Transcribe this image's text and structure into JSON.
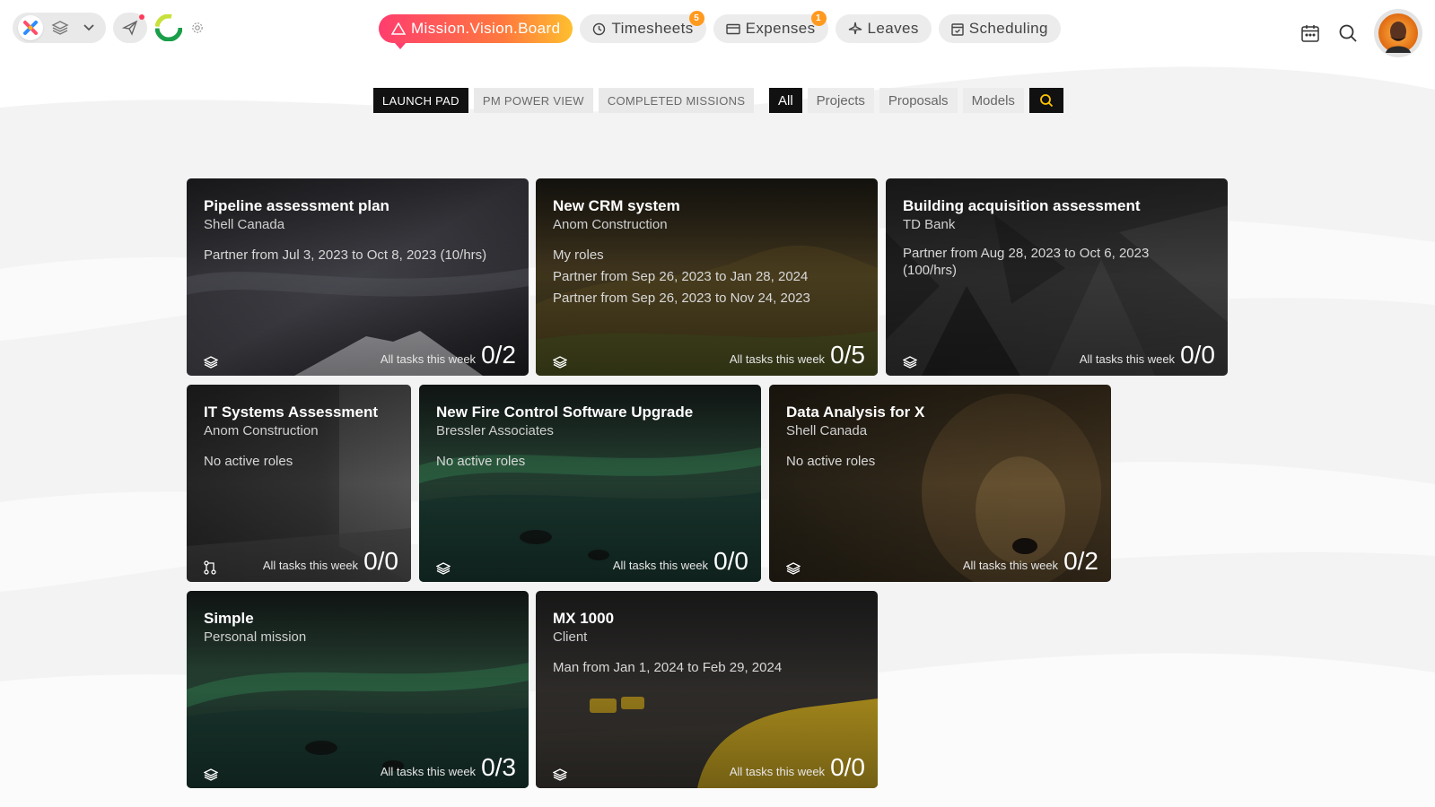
{
  "colors": {
    "accent_gradient": [
      "#ff3d6e",
      "#ff7a3d",
      "#ffbf2f"
    ],
    "badge": "#ff9a1f",
    "dark": "#111111",
    "search_glyph": "#ffc400"
  },
  "topbar": {
    "left_icons": [
      "app-logo-icon",
      "layers-icon",
      "chevron-down-icon",
      "send-icon",
      "sync-status-icon",
      "settings-icon"
    ],
    "nav_tabs": [
      {
        "label": "Mission.Vision.Board",
        "icon": "warning-triangle-icon",
        "active": true,
        "badge": ""
      },
      {
        "label": "Timesheets",
        "icon": "clock-icon",
        "active": false,
        "badge": "5"
      },
      {
        "label": "Expenses",
        "icon": "card-icon",
        "active": false,
        "badge": "1"
      },
      {
        "label": "Leaves",
        "icon": "plane-icon",
        "active": false,
        "badge": ""
      },
      {
        "label": "Scheduling",
        "icon": "calendar-check-icon",
        "active": false,
        "badge": ""
      }
    ],
    "right_icons": [
      "calendar-icon",
      "search-icon",
      "avatar"
    ]
  },
  "subnav": {
    "items": [
      {
        "label": "LAUNCH PAD",
        "active": true
      },
      {
        "label": "PM POWER VIEW",
        "active": false
      },
      {
        "label": "COMPLETED MISSIONS",
        "active": false
      }
    ]
  },
  "filters": {
    "items": [
      {
        "label": "All",
        "active": true
      },
      {
        "label": "Projects",
        "active": false
      },
      {
        "label": "Proposals",
        "active": false
      },
      {
        "label": "Models",
        "active": false
      }
    ],
    "search_icon": "search-icon"
  },
  "cards": [
    {
      "title": "Pipeline assessment plan",
      "client": "Shell Canada",
      "lines": [
        "Partner from Jul 3, 2023 to Oct 8, 2023 (10/hrs)"
      ],
      "footer_label": "All tasks this week",
      "count": "0/2",
      "icon": "layers-icon",
      "theme": "mountain"
    },
    {
      "title": "New CRM system",
      "client": "Anom Construction",
      "lines": [
        "My roles",
        "Partner from Sep 26, 2023 to Jan 28, 2024",
        "Partner from Sep 26, 2023 to Nov 24, 2023"
      ],
      "footer_label": "All tasks this week",
      "count": "0/5",
      "icon": "layers-icon",
      "theme": "hills"
    },
    {
      "title": "Building acquisition assessment",
      "client": "TD Bank",
      "lines": [
        "Partner from Aug 28, 2023 to Oct 6, 2023",
        "(100/hrs)"
      ],
      "footer_label": "All tasks this week",
      "count": "0/0",
      "icon": "layers-icon",
      "theme": "poly"
    },
    {
      "title": "IT Systems Assessment",
      "client": "Anom Construction",
      "lines": [
        "No active roles"
      ],
      "footer_label": "All tasks this week",
      "count": "0/0",
      "icon": "branch-icon",
      "theme": "concrete"
    },
    {
      "title": "New Fire Control Software Upgrade",
      "client": "Bressler Associates",
      "lines": [
        "No active roles"
      ],
      "footer_label": "All tasks this week",
      "count": "0/0",
      "icon": "layers-icon",
      "theme": "aurora"
    },
    {
      "title": "Data Analysis for X",
      "client": "Shell Canada",
      "lines": [
        "No active roles"
      ],
      "footer_label": "All tasks this week",
      "count": "0/2",
      "icon": "layers-icon",
      "theme": "lion"
    },
    {
      "title": "Simple",
      "client": "Personal mission",
      "lines": [],
      "footer_label": "All tasks this week",
      "count": "0/3",
      "icon": "layers-icon",
      "theme": "aurora"
    },
    {
      "title": "MX 1000",
      "client": "Client",
      "lines": [
        "Man from Jan 1, 2024 to Feb 29, 2024"
      ],
      "footer_label": "All tasks this week",
      "count": "0/0",
      "icon": "layers-icon",
      "theme": "taxi"
    }
  ]
}
